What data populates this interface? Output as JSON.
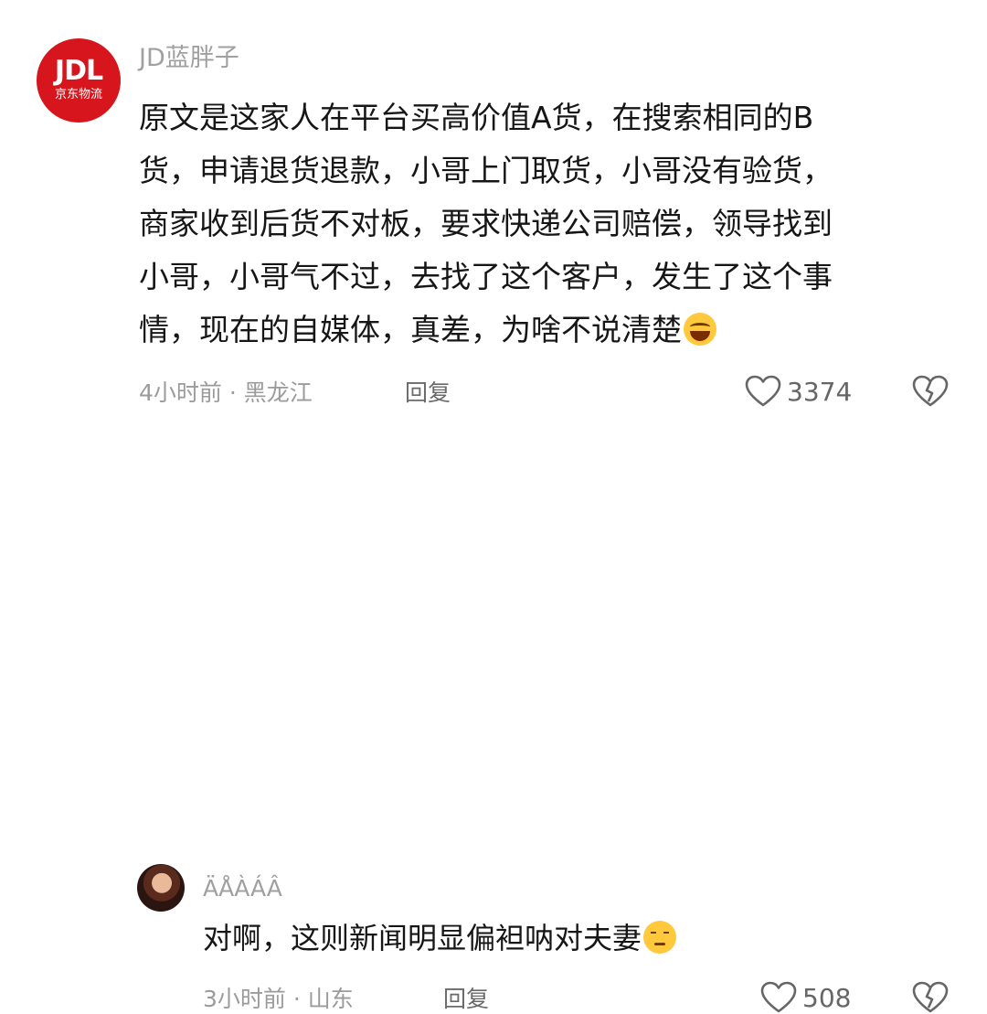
{
  "comments": [
    {
      "avatar": {
        "brand": "JDL",
        "sub": "京东物流",
        "color": "#d6161c"
      },
      "username": "JD蓝胖子",
      "text": "原文是这家人在平台买高价值A货，在搜索相同的B\n货，申请退货退款，小哥上门取货，小哥没有验货，\n商家收到后货不对板，要求快递公司赔偿，领导找到\n小哥，小哥气不过，去找了这个客户，发生了这个事\n情，现在的自媒体，真差，为啥不说清楚",
      "emoji": "laughing-crying-emoji",
      "meta": "4小时前 · 黑龙江",
      "reply_label": "回复",
      "likes": "3374"
    },
    {
      "avatar": {
        "overlay_text": ""
      },
      "username": "ÄÅÀÁÂ",
      "text": "对啊，这则新闻明显偏袒呐对夫妻",
      "emoji": "unamused-emoji",
      "meta": "3小时前 · 山东",
      "reply_label": "回复",
      "likes": "508"
    }
  ],
  "icons": {
    "like": "heart-outline-icon",
    "dislike": "broken-heart-icon"
  }
}
